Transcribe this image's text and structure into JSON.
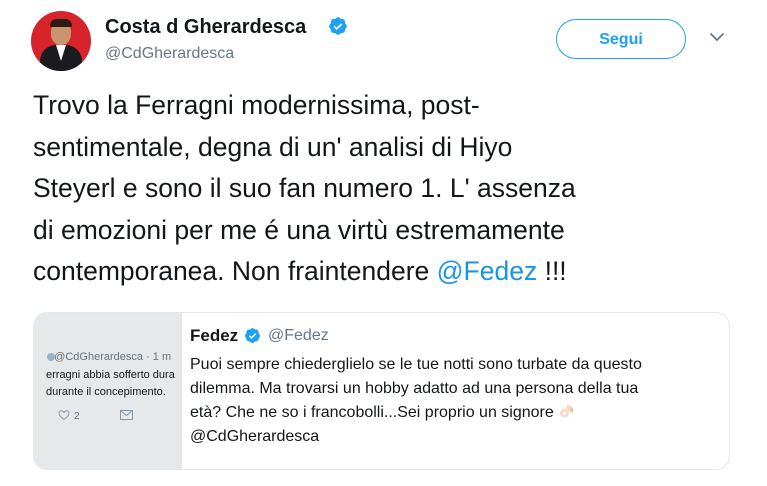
{
  "author": {
    "name": "Costa d Gherardesca",
    "handle": "@CdGherardesca",
    "verified": true
  },
  "follow_button": {
    "label": "Segui"
  },
  "menu": {
    "icon": "chevron-down-icon"
  },
  "tweet": {
    "lines": [
      "Trovo la Ferragni modernissima,  post-",
      "sentimentale, degna di un' analisi di Hiyo",
      "Steyerl e sono il suo fan numero 1. L' assenza",
      "di emozioni per me é una virtù estremamente",
      "contemporanea. Non fraintendere "
    ],
    "mention": "@Fedez",
    "suffix": " !!!"
  },
  "quoted": {
    "name": "Fedez",
    "handle": "@Fedez",
    "verified": true,
    "lines": [
      "Puoi sempre chiederglielo se le tue notti sono turbate da questo",
      "dilemma. Ma trovarsi un hobby adatto ad una persona della tua",
      "età? Che ne so i francobolli...Sei proprio un signore",
      "@CdGherardesca"
    ],
    "emoji": "ok-hand-emoji",
    "thumbnail": {
      "header": "@CdGherardesca · 1 m",
      "line1": "erragni abbia sofferto dura",
      "line2": "durante il concepimento.",
      "likes": "2"
    }
  },
  "colors": {
    "accent": "#1da1f2",
    "mention": "#1b95e0",
    "text": "#14171a",
    "secondary": "#657786",
    "border": "#e1e8ed"
  }
}
